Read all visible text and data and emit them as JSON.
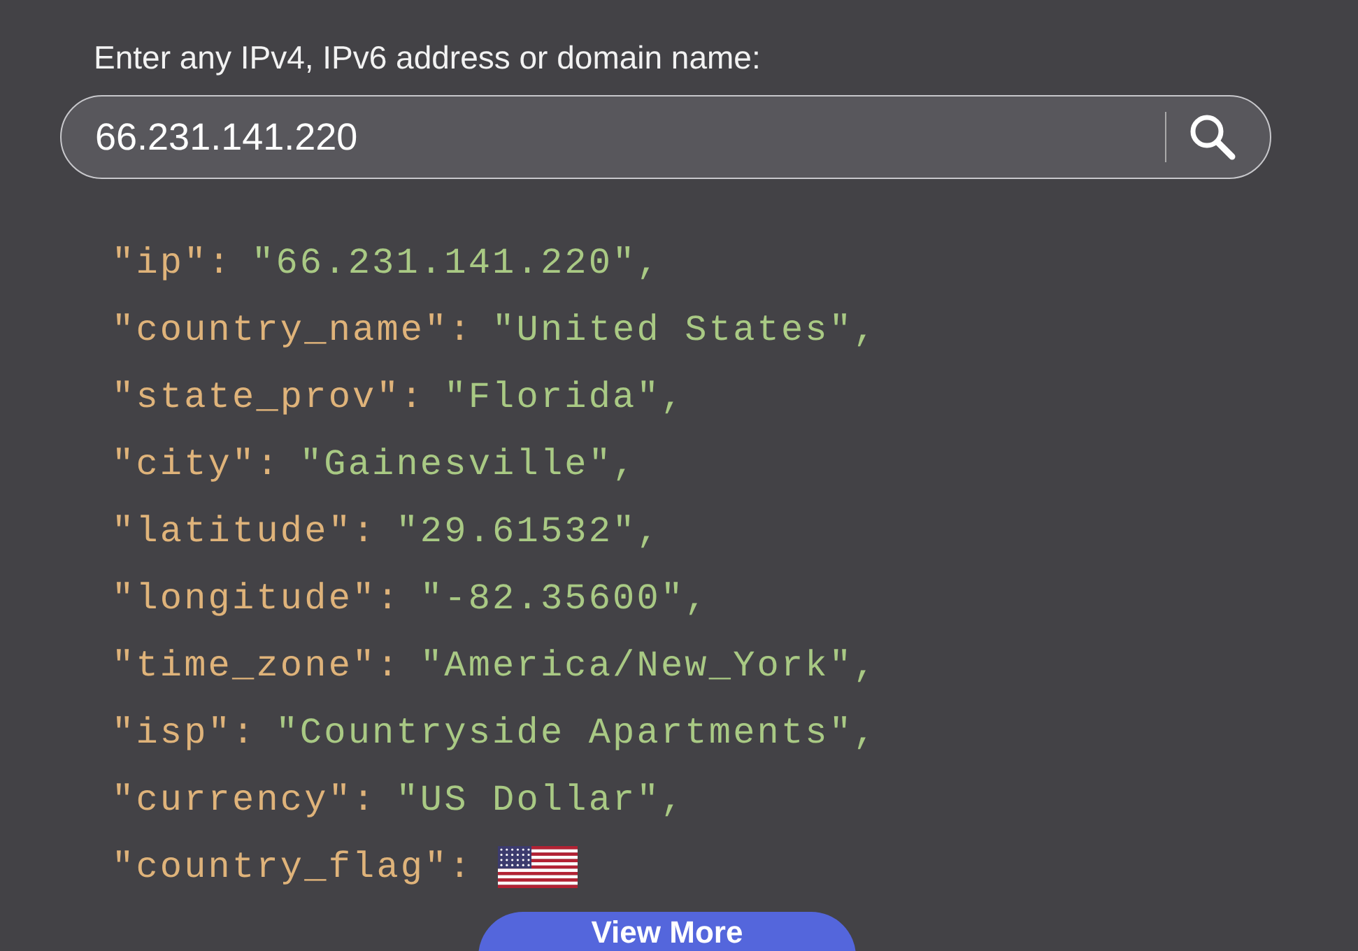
{
  "search": {
    "label": "Enter any IPv4, IPv6 address or domain name:",
    "value": "66.231.141.220"
  },
  "result": [
    {
      "kind": "text",
      "key": "\"ip\":",
      "value": "\"66.231.141.220\","
    },
    {
      "kind": "text",
      "key": "\"country_name\":",
      "value": "\"United States\","
    },
    {
      "kind": "text",
      "key": "\"state_prov\":",
      "value": "\"Florida\","
    },
    {
      "kind": "text",
      "key": "\"city\":",
      "value": "\"Gainesville\","
    },
    {
      "kind": "text",
      "key": "\"latitude\":",
      "value": "\"29.61532\","
    },
    {
      "kind": "text",
      "key": "\"longitude\":",
      "value": "\"-82.35600\","
    },
    {
      "kind": "text",
      "key": "\"time_zone\":",
      "value": "\"America/New_York\","
    },
    {
      "kind": "text",
      "key": "\"isp\":",
      "value": "\"Countryside Apartments\","
    },
    {
      "kind": "text",
      "key": "\"currency\":",
      "value": "\"US Dollar\","
    },
    {
      "kind": "flag",
      "key": "\"country_flag\":"
    }
  ],
  "button": "View More"
}
